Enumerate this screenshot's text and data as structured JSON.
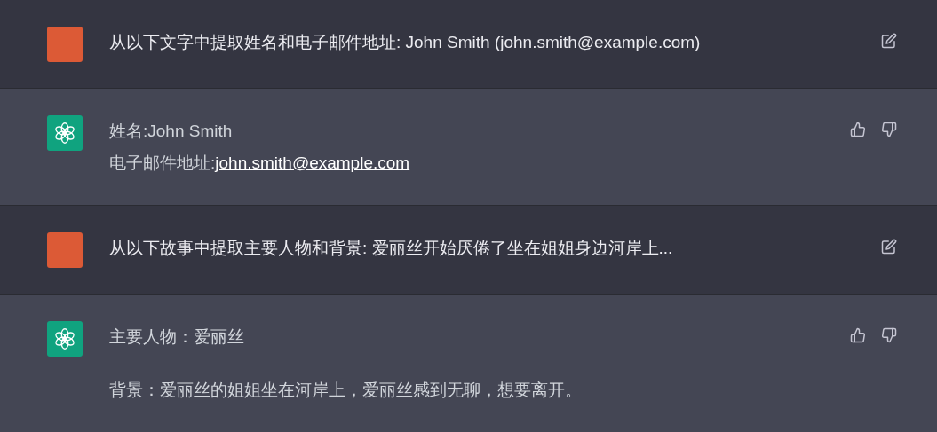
{
  "messages": [
    {
      "kind": "user",
      "text": "从以下文字中提取姓名和电子邮件地址: John Smith (john.smith@example.com)"
    },
    {
      "kind": "assistant",
      "paragraphs": [
        [
          {
            "text": "姓名:John Smith"
          },
          {
            "text": "电子邮件地址:",
            "link": "john.smith@example.com"
          }
        ]
      ]
    },
    {
      "kind": "user",
      "text": "从以下故事中提取主要人物和背景: 爱丽丝开始厌倦了坐在姐姐身边河岸上..."
    },
    {
      "kind": "assistant",
      "paragraphs": [
        [
          {
            "text": "主要人物：爱丽丝"
          }
        ],
        [
          {
            "text": "背景：爱丽丝的姐姐坐在河岸上，爱丽丝感到无聊，想要离开。"
          }
        ]
      ]
    }
  ]
}
